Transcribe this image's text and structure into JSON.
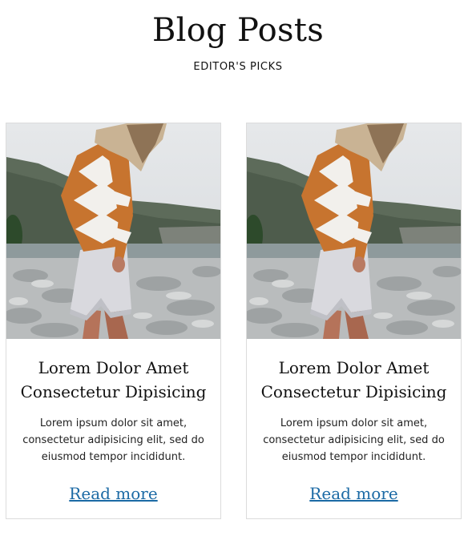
{
  "header": {
    "title": "Blog Posts",
    "subtitle": "EDITOR'S PICKS"
  },
  "posts": [
    {
      "title": "Lorem Dolor Amet Consectetur Dipisicing",
      "excerpt": "Lorem ipsum dolor sit amet, consectetur adipisicing elit, sed do eiusmod tempor incididunt.",
      "link_label": "Read more"
    },
    {
      "title": "Lorem Dolor Amet Consectetur Dipisicing",
      "excerpt": "Lorem ipsum dolor sit amet, consectetur adipisicing elit, sed do eiusmod tempor incididunt.",
      "link_label": "Read more"
    }
  ],
  "colors": {
    "link": "#1b6aa5",
    "card_border": "#dcdcdc",
    "sweater_orange": "#c7742f"
  }
}
